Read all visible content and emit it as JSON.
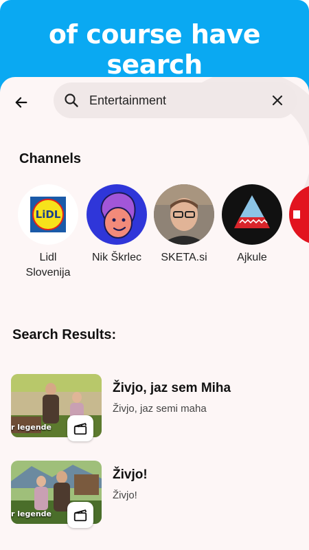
{
  "promo": {
    "headline": "of course have search"
  },
  "search": {
    "value": "Entertainment"
  },
  "channels": {
    "title": "Channels",
    "items": [
      {
        "name": "Lidl\nSlovenija",
        "logo_text": "LiDL"
      },
      {
        "name": "Nik Škrlec"
      },
      {
        "name": "SKETA.si"
      },
      {
        "name": "Ajkule"
      }
    ]
  },
  "results": {
    "title": "Search Results:",
    "items": [
      {
        "title": "Živjo, jaz sem Miha",
        "subtitle": "Živjo, jaz semi maha",
        "thumb_caption": "r legende"
      },
      {
        "title": "Živjo!",
        "subtitle": "Živjo!",
        "thumb_caption": "r legende"
      }
    ]
  },
  "colors": {
    "promo_bg": "#0aa9f2",
    "screen_bg": "#fdf6f6",
    "search_bg": "#f0e8e8"
  },
  "icons": {
    "back": "arrow-left-icon",
    "search": "search-icon",
    "clear": "close-icon",
    "video": "clapperboard-icon"
  }
}
